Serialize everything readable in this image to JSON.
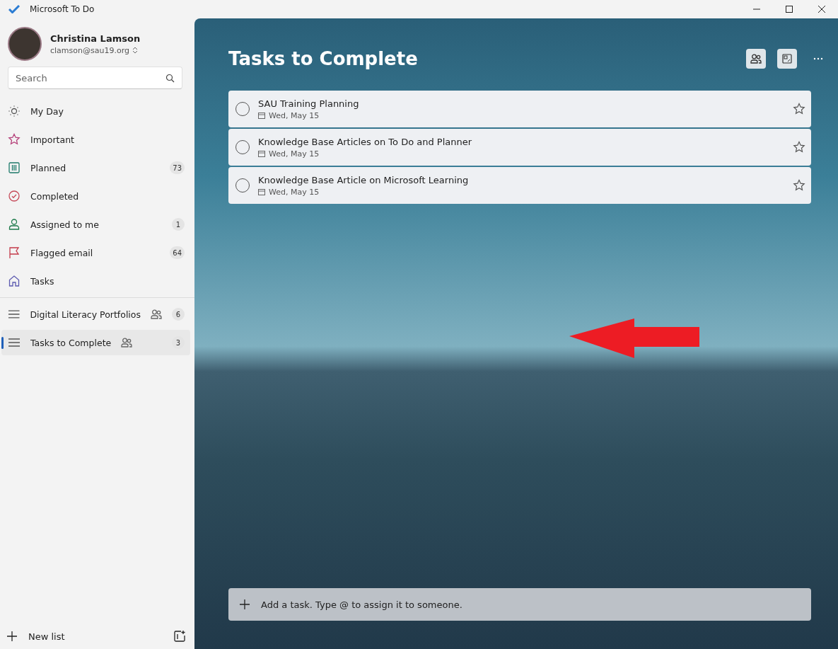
{
  "window": {
    "title": "Microsoft To Do"
  },
  "account": {
    "name": "Christina Lamson",
    "email": "clamson@sau19.org"
  },
  "search": {
    "placeholder": "Search"
  },
  "smart_lists": [
    {
      "label": "My Day",
      "selected": false
    },
    {
      "label": "Important",
      "selected": false
    },
    {
      "label": "Planned",
      "count": "73",
      "selected": false
    },
    {
      "label": "Completed",
      "selected": false
    },
    {
      "label": "Assigned to me",
      "count": "1",
      "selected": false
    },
    {
      "label": "Flagged email",
      "count": "64",
      "selected": false
    },
    {
      "label": "Tasks",
      "selected": false
    }
  ],
  "lists": [
    {
      "label": "Digital Literacy Portfolios",
      "shared": true,
      "count": "6",
      "selected": false
    },
    {
      "label": "Tasks to Complete",
      "shared": true,
      "count": "3",
      "selected": true
    }
  ],
  "new_list": {
    "label": "New list"
  },
  "main": {
    "title": "Tasks to Complete"
  },
  "tasks": [
    {
      "title": "SAU Training Planning",
      "due": "Wed, May 15",
      "completed": false,
      "important": false
    },
    {
      "title": "Knowledge Base Articles on To Do and Planner",
      "due": "Wed, May 15",
      "completed": false,
      "important": false
    },
    {
      "title": "Knowledge Base Article on Microsoft Learning",
      "due": "Wed, May 15",
      "completed": false,
      "important": false
    }
  ],
  "add_task": {
    "placeholder": "Add a task. Type @ to assign it to someone."
  }
}
